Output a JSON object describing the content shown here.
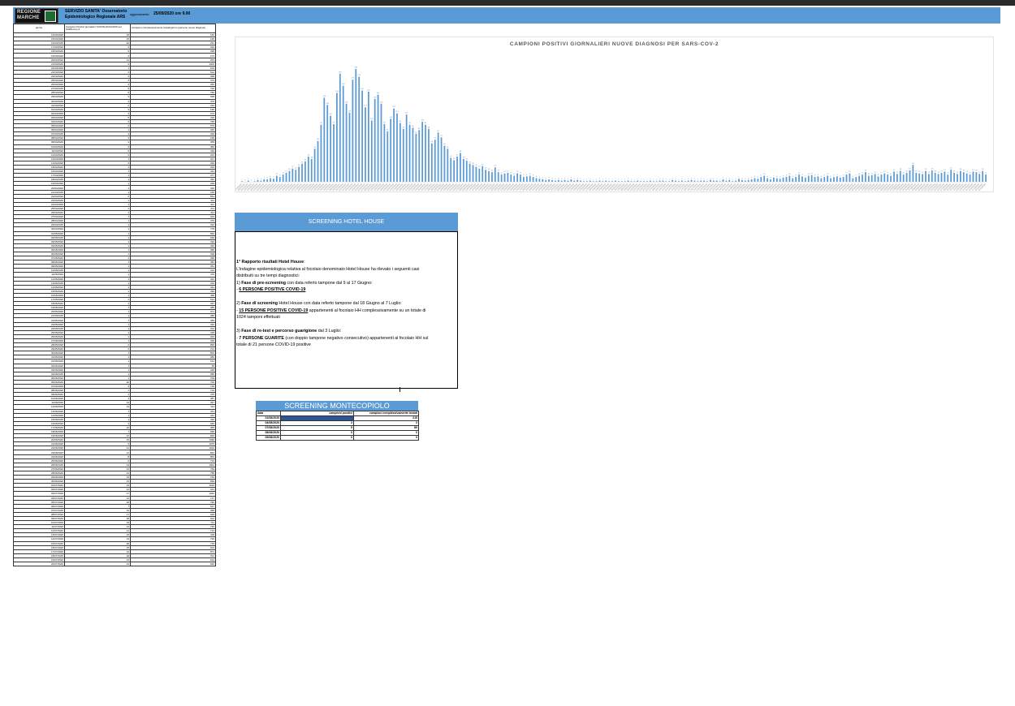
{
  "header": {
    "logo_text": "REGIONE MARCHE",
    "org_line1": "SERVIZIO SANITA' Osservatorio",
    "org_line2": "Epidemiologico Regionale ARS",
    "update_label": "aggiornamento:",
    "update_value": "25/09/2020 ore 9.00"
  },
  "table": {
    "col_date": "giorno",
    "col_pos": "Campioni Positivi giornalieri NUOVE DIAGNOSI per SARS-Cov-2",
    "col_tot": "Campioni complessivamente testati/giorno (persone nuove diagnosi)",
    "rows": [
      [
        "14/03/2020",
        "16",
        "182"
      ],
      [
        "15/03/2020",
        "15",
        "195"
      ],
      [
        "16/03/2020",
        "22",
        "261"
      ],
      [
        "17/03/2020",
        "4",
        "322"
      ],
      [
        "18/03/2020",
        "6",
        "338"
      ],
      [
        "19/03/2020",
        "3",
        "274"
      ],
      [
        "20/03/2020",
        "11",
        "253"
      ],
      [
        "21/03/2020",
        "6",
        "1000"
      ],
      [
        "22/03/2020",
        "1",
        "619"
      ],
      [
        "23/03/2020",
        "3",
        "512"
      ],
      [
        "24/03/2020",
        "3",
        "268"
      ],
      [
        "25/03/2020",
        "2",
        "373"
      ],
      [
        "26/03/2020",
        "4",
        "365"
      ],
      [
        "27/03/2020",
        "5",
        "736"
      ],
      [
        "28/03/2020",
        "5",
        "750"
      ],
      [
        "29/03/2020",
        "4",
        "638"
      ],
      [
        "30/03/2020",
        "3",
        "376"
      ],
      [
        "31/03/2020",
        "2",
        "232"
      ],
      [
        "01/04/2020",
        "3",
        "196"
      ],
      [
        "02/04/2020",
        "4",
        "374"
      ],
      [
        "03/04/2020",
        "5",
        "415"
      ],
      [
        "04/04/2020",
        "3",
        "766"
      ],
      [
        "05/04/2020",
        "2",
        "579"
      ],
      [
        "06/04/2020",
        "1",
        "325"
      ],
      [
        "07/04/2020",
        "3",
        "339"
      ],
      [
        "08/04/2020",
        "3",
        "199"
      ],
      [
        "09/04/2020",
        "4",
        "359"
      ],
      [
        "10/04/2020",
        "3",
        "484"
      ],
      [
        "11/04/2020",
        "6",
        "339"
      ],
      [
        "12/04/2020",
        "3",
        "334"
      ],
      [
        "13/04/2020",
        "1",
        "327"
      ],
      [
        "14/04/2020",
        "3",
        "339"
      ],
      [
        "15/04/2020",
        "1",
        "433"
      ],
      [
        "16/04/2020",
        "1",
        "441"
      ],
      [
        "17/04/2020",
        "1",
        "377"
      ],
      [
        "18/04/2020",
        "1",
        "452"
      ],
      [
        "19/04/2020",
        "1",
        "329"
      ],
      [
        "20/04/2020",
        "1",
        "330"
      ],
      [
        "21/04/2020",
        "1",
        "155"
      ],
      [
        "22/04/2020",
        "2",
        "561"
      ],
      [
        "23/04/2020",
        "1",
        "311"
      ],
      [
        "24/04/2020",
        "1",
        "421"
      ],
      [
        "25/04/2020",
        "1",
        "474"
      ],
      [
        "26/04/2020",
        "1",
        "411"
      ],
      [
        "27/04/2020",
        "1",
        "324"
      ],
      [
        "28/04/2020",
        "1",
        "379"
      ],
      [
        "29/04/2020",
        "1",
        "322"
      ],
      [
        "30/04/2020",
        "1",
        "778"
      ],
      [
        "01/05/2020",
        "1",
        "560"
      ],
      [
        "02/05/2020",
        "1",
        "669"
      ],
      [
        "03/05/2020",
        "1",
        "332"
      ],
      [
        "04/05/2020",
        "1",
        "432"
      ],
      [
        "05/05/2020",
        "1",
        "385"
      ],
      [
        "06/05/2020",
        "1",
        "328"
      ],
      [
        "07/05/2020",
        "1",
        "396"
      ],
      [
        "08/05/2020",
        "1",
        "384"
      ],
      [
        "09/05/2020",
        "1",
        "351"
      ],
      [
        "10/05/2020",
        "1",
        "312"
      ],
      [
        "11/05/2020",
        "1",
        "476"
      ],
      [
        "12/05/2020",
        "1",
        "322"
      ],
      [
        "13/05/2020",
        "1",
        "333"
      ],
      [
        "14/05/2020",
        "1",
        "431"
      ],
      [
        "15/05/2020",
        "1",
        "336"
      ],
      [
        "16/05/2020",
        "1",
        "458"
      ],
      [
        "17/05/2020",
        "1",
        "513"
      ],
      [
        "18/05/2020",
        "1",
        "347"
      ],
      [
        "19/05/2020",
        "1",
        "385"
      ],
      [
        "20/05/2020",
        "1",
        "371"
      ],
      [
        "21/05/2020",
        "1",
        "380"
      ],
      [
        "22/05/2020",
        "1",
        "389"
      ],
      [
        "23/05/2020",
        "1",
        "330"
      ],
      [
        "24/05/2020",
        "1",
        "334"
      ],
      [
        "25/05/2020",
        "1",
        "318"
      ],
      [
        "26/05/2020",
        "1",
        "333"
      ],
      [
        "27/05/2020",
        "1",
        "369"
      ],
      [
        "28/05/2020",
        "2",
        "896"
      ],
      [
        "29/05/2020",
        "2",
        "701"
      ],
      [
        "30/05/2020",
        "1",
        "502"
      ],
      [
        "31/05/2020",
        "1",
        "383"
      ],
      [
        "01/06/2020",
        "1",
        "161"
      ],
      [
        "02/06/2020",
        "1",
        "58"
      ],
      [
        "03/06/2020",
        "1",
        "248"
      ],
      [
        "04/06/2020",
        "1",
        "385"
      ],
      [
        "05/06/2020",
        "1",
        "709"
      ],
      [
        "06/06/2020",
        "20",
        "700"
      ],
      [
        "07/06/2020",
        "3",
        "728"
      ],
      [
        "08/06/2020",
        "1",
        "719"
      ],
      [
        "09/06/2020",
        "1",
        "475"
      ],
      [
        "10/06/2020",
        "1",
        "387"
      ],
      [
        "11/06/2020",
        "14",
        "397"
      ],
      [
        "12/06/2020",
        "13",
        "411"
      ],
      [
        "13/06/2020",
        "1",
        "341"
      ],
      [
        "14/06/2020",
        "1",
        "421"
      ],
      [
        "15/06/2020",
        "1",
        "320"
      ],
      [
        "16/06/2020",
        "3",
        "620"
      ],
      [
        "17/06/2020",
        "10",
        "383"
      ],
      [
        "18/06/2020",
        "7",
        "996"
      ],
      [
        "19/06/2020",
        "12",
        "826"
      ],
      [
        "20/06/2020",
        "15",
        "1090"
      ],
      [
        "21/06/2020",
        "5",
        "1075"
      ],
      [
        "22/06/2020",
        "11",
        "1044"
      ],
      [
        "23/06/2020",
        "11",
        "822"
      ],
      [
        "24/06/2020",
        "8",
        "854"
      ],
      [
        "25/06/2020",
        "6",
        "723"
      ],
      [
        "26/06/2020",
        "14",
        "1001"
      ],
      [
        "27/06/2020",
        "12",
        "769"
      ],
      [
        "28/06/2020",
        "12",
        "758"
      ],
      [
        "29/06/2020",
        "10",
        "763"
      ],
      [
        "30/06/2020",
        "15",
        "839"
      ],
      [
        "01/07/2020",
        "19",
        "1016"
      ],
      [
        "02/07/2020",
        "12",
        "914"
      ],
      [
        "03/07/2020",
        "17",
        "1042"
      ],
      [
        "04/07/2020",
        "13",
        "717"
      ],
      [
        "05/07/2020",
        "18",
        "780"
      ],
      [
        "06/07/2020",
        "7",
        "547"
      ],
      [
        "07/07/2020",
        "12",
        "958"
      ],
      [
        "08/07/2020",
        "17",
        "928"
      ],
      [
        "09/07/2020",
        "18",
        "924"
      ],
      [
        "10/07/2020",
        "19",
        "711"
      ],
      [
        "11/07/2020",
        "13",
        "730"
      ],
      [
        "12/07/2020",
        "12",
        "712"
      ],
      [
        "13/07/2020",
        "19",
        "418"
      ],
      [
        "14/07/2020",
        "13",
        "720"
      ],
      [
        "15/07/2020",
        "28",
        "715"
      ],
      [
        "16/07/2020",
        "15",
        "913"
      ],
      [
        "17/07/2020",
        "14",
        "871"
      ],
      [
        "18/07/2020",
        "18",
        "511"
      ],
      [
        "19/07/2020",
        "13",
        "622"
      ],
      [
        "20/07/2020",
        "13",
        "620"
      ]
    ]
  },
  "chart_data": {
    "type": "bar",
    "title": "CAMPIONI POSITIVI GIORNALIERI NUOVE DIAGNOSI PER SARS-COV-2",
    "start_date": "27/02/2020",
    "ylim": [
      0,
      200
    ],
    "values": [
      1,
      0,
      2,
      0,
      1,
      3,
      2,
      4,
      4,
      6,
      5,
      10,
      8,
      12,
      15,
      18,
      22,
      20,
      25,
      30,
      34,
      42,
      38,
      55,
      68,
      95,
      140,
      128,
      110,
      96,
      148,
      180,
      160,
      130,
      115,
      170,
      188,
      175,
      152,
      124,
      150,
      102,
      138,
      145,
      130,
      96,
      84,
      105,
      122,
      114,
      98,
      88,
      112,
      95,
      90,
      80,
      86,
      100,
      95,
      88,
      64,
      70,
      82,
      74,
      60,
      55,
      40,
      36,
      42,
      48,
      38,
      35,
      30,
      28,
      25,
      22,
      26,
      20,
      18,
      16,
      24,
      16,
      12,
      14,
      15,
      12,
      10,
      14,
      12,
      8,
      9,
      10,
      8,
      6,
      5,
      4,
      3,
      4,
      3,
      2,
      3,
      2,
      3,
      2,
      4,
      2,
      3,
      2,
      1,
      1,
      2,
      1,
      1,
      2,
      1,
      2,
      1,
      1,
      2,
      1,
      1,
      1,
      2,
      1,
      1,
      2,
      1,
      1,
      1,
      2,
      1,
      1,
      2,
      2,
      1,
      1,
      3,
      2,
      1,
      2,
      1,
      2,
      3,
      2,
      1,
      2,
      2,
      1,
      3,
      2,
      2,
      1,
      4,
      2,
      3,
      1,
      2,
      5,
      3,
      2,
      3,
      4,
      6,
      5,
      8,
      10,
      6,
      4,
      7,
      6,
      5,
      7,
      8,
      10,
      6,
      8,
      12,
      9,
      7,
      10,
      11,
      8,
      9,
      6,
      8,
      10,
      6,
      8,
      9,
      7,
      8,
      12,
      14,
      6,
      8,
      10,
      12,
      16,
      10,
      11,
      13,
      9,
      12,
      14,
      12,
      10,
      17,
      13,
      18,
      12,
      15,
      19,
      28,
      15,
      14,
      13,
      18,
      13,
      19,
      15,
      13,
      15,
      17,
      12,
      20,
      15,
      13,
      18,
      16,
      14,
      12,
      17,
      16,
      13,
      18,
      12
    ]
  },
  "hotel_house": {
    "header": "SCREENING HOTEL HOUSE",
    "report_title": "1° Rapporto  risultati Hotel House",
    "intro1": "L'indagine epidemiologica relativa al focolaio denominato Hotel House ha rilevato i seguenti casi",
    "intro2": "distribuiti su tre tempi diagnostici:",
    "p1_num": "1) ",
    "p1_bold": "Fase di pre-screening",
    "p1_rest": " con data referto tampone dal 9 al 17 Giugno:",
    "p1_dash": "- ",
    "p1_result": "6 PERSONE POSITIVE COVID-19",
    "p2_num": "2) ",
    "p2_bold": "Fase di screening",
    "p2_rest": " Hotel House con data referto tampone dal 18 Giugno al 7 Luglio:",
    "p2_dash": "- ",
    "p2_result": "15 PERSONE POSITIVE COVID-19",
    "p2_tail": " appartenenti al focolaio HH complessivamente su un totale di",
    "p2_tail2": "1024 tamponi effettuati",
    "p3_num": "3) ",
    "p3_bold": "Fase di re-test e percorso guarigione",
    "p3_rest": " dal 3 Luglio:",
    "p3_dash": "- ",
    "p3_result": "7 PERSONE GUARITE",
    "p3_tail": " (con doppio tampone negativo consecutivo) appartenenti al focolaio HH sul",
    "p3_tail2": "totale di 21 persone COVID-19 positive"
  },
  "montecopiolo": {
    "title": "SCREENING MONTECOPIOLO",
    "col_date": "data",
    "col_pos": "campioni positivi",
    "col_tot": "campioni complessivamente testati",
    "rows": [
      [
        "01/08/2020",
        "",
        "215"
      ],
      [
        "04/08/2020",
        "3",
        "3"
      ],
      [
        "07/08/2020",
        "5",
        "89"
      ],
      [
        "08/08/2020",
        "0",
        "0"
      ],
      [
        "09/08/2020",
        "0",
        "0"
      ]
    ]
  }
}
